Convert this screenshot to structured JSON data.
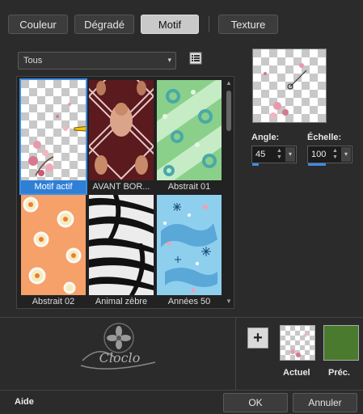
{
  "tabs": [
    {
      "label": "Couleur"
    },
    {
      "label": "Dégradé"
    },
    {
      "label": "Motif"
    },
    {
      "label": "Texture"
    }
  ],
  "active_tab": "Motif",
  "category_select": {
    "value": "Tous"
  },
  "patterns": [
    {
      "caption": "Motif actif",
      "icon": "cherry-blossom-checker-pattern",
      "selected": true
    },
    {
      "caption": "AVANT BOR...",
      "icon": "woman-diamond-frame-pattern"
    },
    {
      "caption": "Abstrait 01",
      "icon": "green-circles-pattern"
    },
    {
      "caption": "Abstrait 02",
      "icon": "orange-circles-pattern"
    },
    {
      "caption": "Animal zèbre",
      "icon": "zebra-stripes-pattern"
    },
    {
      "caption": "Années 50",
      "icon": "fifties-atomic-pattern"
    }
  ],
  "angle": {
    "label": "Angle:",
    "value": "45"
  },
  "scale": {
    "label": "Échelle:",
    "value": "100"
  },
  "current_label": "Actuel",
  "previous_label": "Préc.",
  "previous_color": "#4a7a2e",
  "accent_color": "#3a8ee6",
  "buttons": {
    "help": "Aide",
    "ok": "OK",
    "cancel": "Annuler"
  },
  "watermark_text": "Cloclo"
}
